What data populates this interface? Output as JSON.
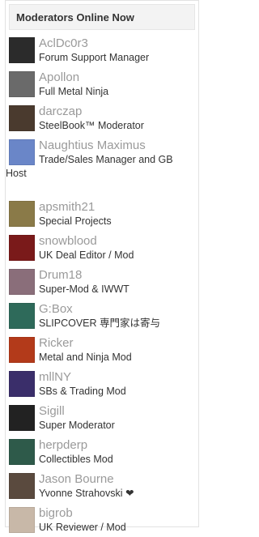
{
  "header": {
    "title": "Moderators Online Now"
  },
  "moderators": [
    {
      "username": "AclDc0r3",
      "title": "Forum Support Manager",
      "avatar_color": "#2b2b2b"
    },
    {
      "username": "Apollon",
      "title": "Full Metal Ninja",
      "avatar_color": "#6a6a6a"
    },
    {
      "username": "darczap",
      "title": "SteelBook™ Moderator",
      "avatar_color": "#4a3a2e"
    },
    {
      "username": "Naughtius Maximus",
      "title": "Trade/Sales Manager and GB",
      "title_cont": "Host",
      "avatar_color": "#6a86c8"
    },
    {
      "username": "apsmith21",
      "title": "Special Projects",
      "avatar_color": "#8a7a48"
    },
    {
      "username": "snowblood",
      "title": "UK Deal Editor / Mod",
      "avatar_color": "#7a1a1a"
    },
    {
      "username": "Drum18",
      "title": "Super-Mod & IWWT",
      "avatar_color": "#8a6e7a"
    },
    {
      "username": "G:Box",
      "title": "SLIPCOVER 専門家は寄与",
      "avatar_color": "#2e6a5a"
    },
    {
      "username": "Ricker",
      "title": "Metal and Ninja Mod",
      "avatar_color": "#b33a1a"
    },
    {
      "username": "mllNY",
      "title": "SBs & Trading Mod",
      "avatar_color": "#3a2e6a"
    },
    {
      "username": "Sigill",
      "title": "Super Moderator",
      "avatar_color": "#222222"
    },
    {
      "username": "herpderp",
      "title": "Collectibles Mod",
      "avatar_color": "#2e5a4a"
    },
    {
      "username": "Jason Bourne",
      "title": "Yvonne Strahovski ❤",
      "avatar_color": "#5a4a3e"
    },
    {
      "username": "bigrob",
      "title": "UK Reviewer / Mod",
      "avatar_color": "#c8b8a8"
    }
  ]
}
